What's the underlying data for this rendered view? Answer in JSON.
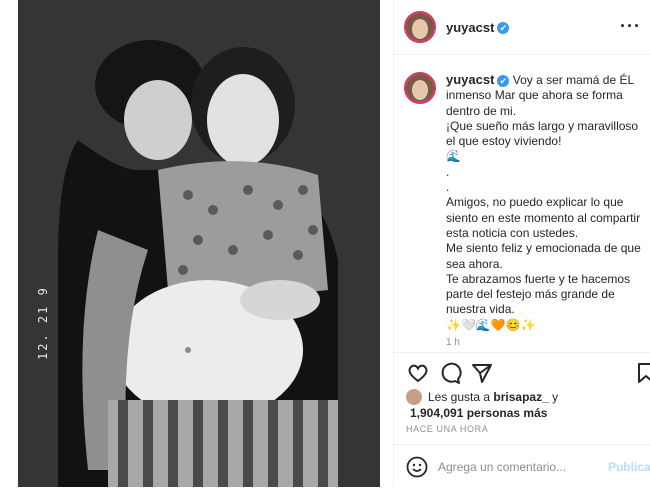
{
  "post": {
    "photo": {
      "date_stamp": "12. 21 9",
      "alt": "black and white photo of couple"
    },
    "header": {
      "username": "yuyacst",
      "verified_glyph": "✔",
      "more_glyph": "···"
    },
    "caption": {
      "username": "yuyacst",
      "lines": [
        "Voy a ser mamá de ÉL inmenso Mar que ahora se forma dentro de mi.",
        "¡Que sueño más largo y maravilloso el que estoy viviendo!",
        "🌊",
        ".",
        ".",
        "Amigos, no puedo explicar lo que siento en este momento al compartir esta noticia con ustedes.",
        "Me siento feliz y emocionada de que sea ahora.",
        "Te abrazamos fuerte y te hacemos parte del festejo más grande de nuestra vida.",
        "✨🤍🌊🧡😊✨"
      ],
      "time": "1 h"
    },
    "actions": {
      "icons": [
        "heart-icon",
        "comment-icon",
        "share-icon",
        "bookmark-icon"
      ]
    },
    "likes": {
      "prefix": "Les gusta a",
      "user": "brisapaz_",
      "connector": "y",
      "count": "1,904,091 personas más"
    },
    "posted_ago": "HACE UNA HORA",
    "comment": {
      "placeholder": "Agrega un comentario...",
      "publish": "Publicar",
      "emoji_icon": "smiley-icon"
    }
  }
}
